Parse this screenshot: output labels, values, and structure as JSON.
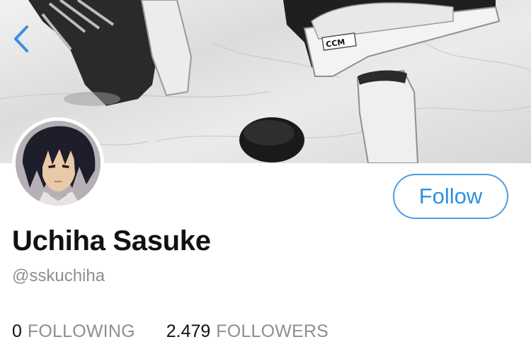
{
  "header": {
    "back_icon": "chevron-left-icon",
    "accent_color": "#2f8fe0",
    "banner_logo_text": "CCM"
  },
  "profile": {
    "display_name": "Uchiha Sasuke",
    "handle": "@sskuchiha",
    "follow_label": "Follow"
  },
  "stats": {
    "following_count": "0",
    "following_label": "FOLLOWING",
    "followers_count": "2.479",
    "followers_label": "FOLLOWERS"
  }
}
